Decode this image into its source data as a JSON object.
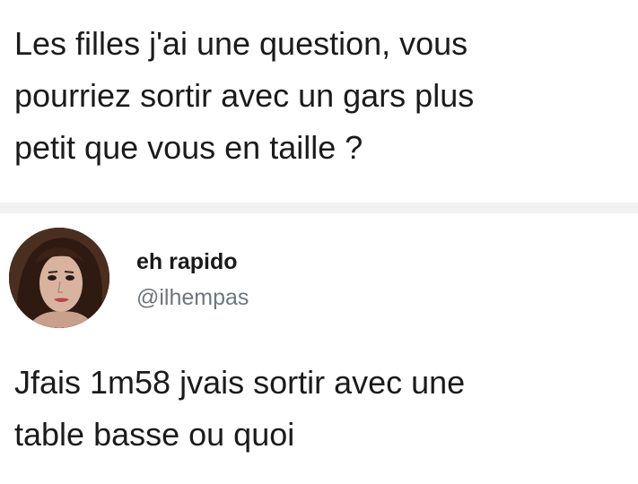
{
  "question": {
    "lines": [
      "Les filles j'ai une question, vous",
      "pourriez sortir avec un gars plus",
      "petit que vous en taille ?"
    ]
  },
  "reply": {
    "author": {
      "display_name": "eh rapido",
      "handle": "@ilhempas",
      "avatar_icon": "profile-photo-avatar"
    },
    "lines": [
      "Jfais 1m58 jvais sortir avec une",
      "table basse ou quoi"
    ]
  },
  "colors": {
    "text": "#1b1b1b",
    "handle": "#6e767d",
    "separator": "#f2f2f2",
    "background": "#ffffff"
  }
}
